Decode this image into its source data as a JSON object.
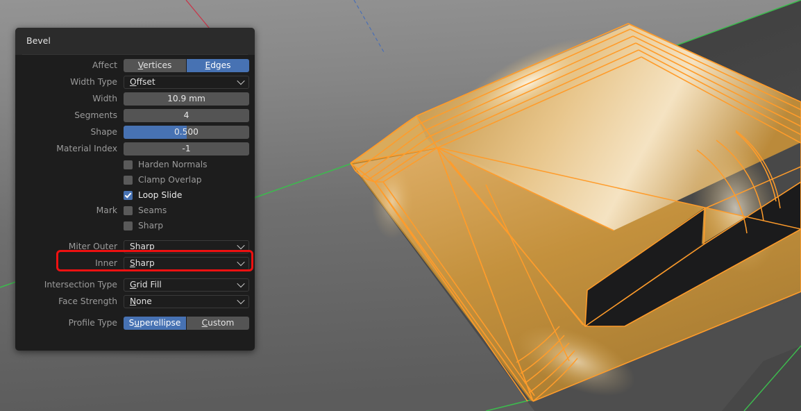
{
  "panel": {
    "title": "Bevel",
    "rows": {
      "affect": {
        "label": "Affect",
        "options": [
          {
            "label": "Vertices",
            "accel": "V",
            "active": false
          },
          {
            "label": "Edges",
            "accel": "E",
            "active": true
          }
        ]
      },
      "width_type": {
        "label": "Width Type",
        "value": "Offset",
        "accel": "O"
      },
      "width": {
        "label": "Width",
        "value": "10.9 mm"
      },
      "segments": {
        "label": "Segments",
        "value": "4"
      },
      "shape": {
        "label": "Shape",
        "value": "0.500",
        "fill_percent": 50
      },
      "material_index": {
        "label": "Material Index",
        "value": "-1"
      },
      "harden_normals": {
        "label": "Harden Normals",
        "checked": false
      },
      "clamp_overlap": {
        "label": "Clamp Overlap",
        "checked": false
      },
      "loop_slide": {
        "label": "Loop Slide",
        "checked": true
      },
      "mark_label": "Mark",
      "mark_seams": {
        "label": "Seams",
        "checked": false
      },
      "mark_sharp": {
        "label": "Sharp",
        "checked": false
      },
      "miter_outer": {
        "label": "Miter Outer",
        "value": "Sharp",
        "accel": "S",
        "highlighted": true
      },
      "miter_inner": {
        "label": "Inner",
        "value": "Sharp",
        "accel": "S"
      },
      "intersection_type": {
        "label": "Intersection Type",
        "value": "Grid Fill",
        "accel": "G"
      },
      "face_strength": {
        "label": "Face Strength",
        "value": "None",
        "accel": "N"
      },
      "profile_type": {
        "label": "Profile Type",
        "options": [
          {
            "label": "Superellipse",
            "accel": "u",
            "active": true
          },
          {
            "label": "Custom",
            "accel": "C",
            "active": false
          }
        ]
      }
    }
  },
  "viewport": {
    "name": "3d-viewport",
    "selection_color": "#ff9c2b",
    "mesh_fill_color": "#c48b36",
    "axis_y_color": "#3dba4e",
    "axis_x_color": "#c8364a",
    "cavity_color": "#1b1b1c",
    "background_top": "#8e8e8e",
    "background_bottom": "#585858",
    "ground_dark": "#4a4a4a",
    "object": "beveled-rectangular-frame"
  },
  "annotation": {
    "highlight_color": "#ee1111",
    "target": "miter-outer-dropdown"
  }
}
